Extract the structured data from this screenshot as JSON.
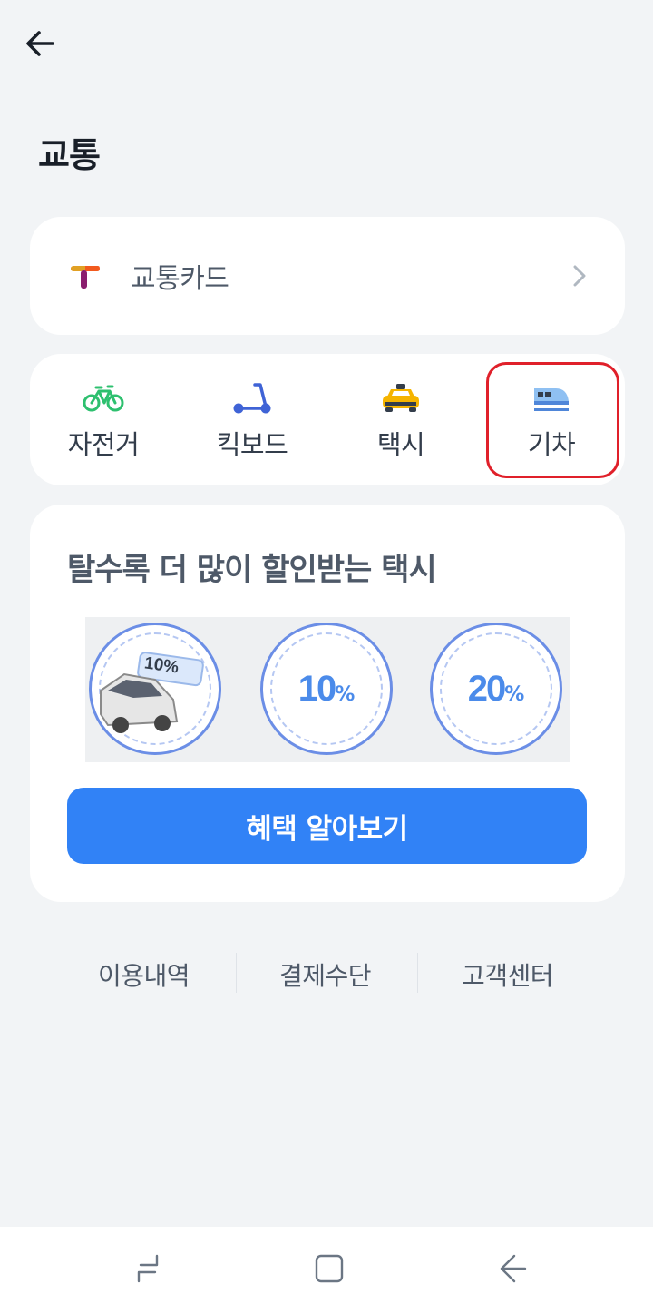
{
  "header": {
    "back_icon": "arrow-left-icon",
    "title": "교통"
  },
  "transit_card": {
    "logo_icon": "tmoney-logo-icon",
    "label": "교통카드",
    "chevron_icon": "chevron-right-icon"
  },
  "modes": [
    {
      "label": "자전거",
      "icon": "bicycle-icon",
      "color": "#2ec06f"
    },
    {
      "label": "킥보드",
      "icon": "scooter-icon",
      "color": "#3f63d6"
    },
    {
      "label": "택시",
      "icon": "taxi-icon",
      "color": "#f5b400"
    },
    {
      "label": "기차",
      "icon": "train-icon",
      "color": "#6aa6e8"
    }
  ],
  "highlight_color": "#e0202a",
  "promo": {
    "title": "탈수록 더 많이 할인받는 택시",
    "badges": [
      {
        "type": "image",
        "icon": "taxi-van-icon",
        "tag": "10%"
      },
      {
        "type": "percent",
        "value": "10",
        "symbol": "%"
      },
      {
        "type": "percent",
        "value": "20",
        "symbol": "%"
      }
    ],
    "button_label": "혜택 알아보기",
    "accent": "#3182f6"
  },
  "footer_links": [
    {
      "label": "이용내역"
    },
    {
      "label": "결제수단"
    },
    {
      "label": "고객센터"
    }
  ],
  "nav_bar": {
    "recent_icon": "recent-apps-icon",
    "home_icon": "home-icon",
    "back_icon": "system-back-icon"
  }
}
